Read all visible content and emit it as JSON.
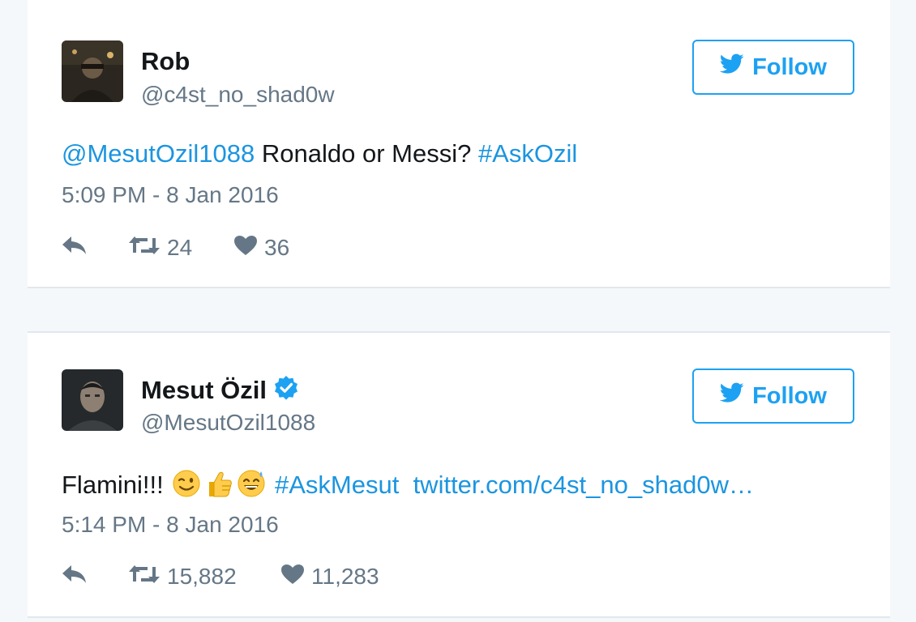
{
  "colors": {
    "twitter_blue": "#1da1f2",
    "link_blue": "#1b95e0",
    "text_dark": "#14171a",
    "text_grey": "#657786",
    "verified": "#1da1f2"
  },
  "tweets": [
    {
      "name": "Rob",
      "verified": false,
      "handle": "@c4st_no_shad0w",
      "follow_label": "Follow",
      "text": {
        "mention": "@MesutOzil1088",
        "body": " Ronaldo or Messi? ",
        "hashtag": "#AskOzil"
      },
      "timestamp": "5:09 PM - 8 Jan 2016",
      "retweets": "24",
      "likes": "36",
      "icons": [
        "reply-icon",
        "retweet-icon",
        "heart-icon",
        "twitter-bird-icon"
      ]
    },
    {
      "name": "Mesut Özil",
      "verified": true,
      "handle": "@MesutOzil1088",
      "follow_label": "Follow",
      "text": {
        "body": "Flamini!!! ",
        "emojis": [
          "winking-face-emoji",
          "thumbs-up-emoji",
          "grinning-sweat-emoji"
        ],
        "hashtag": "#AskMesut",
        "url": "twitter.com/c4st_no_shad0w…"
      },
      "timestamp": "5:14 PM - 8 Jan 2016",
      "retweets": "15,882",
      "likes": "11,283",
      "icons": [
        "verified-badge-icon",
        "reply-icon",
        "retweet-icon",
        "heart-icon",
        "twitter-bird-icon"
      ]
    }
  ]
}
